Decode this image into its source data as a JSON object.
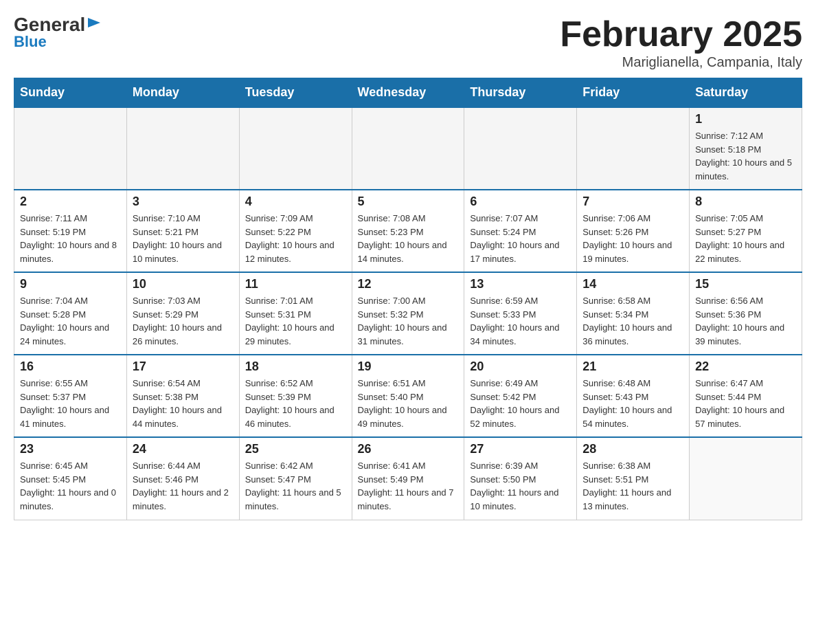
{
  "header": {
    "logo_general": "General",
    "logo_blue": "Blue",
    "month_title": "February 2025",
    "location": "Mariglianella, Campania, Italy"
  },
  "weekdays": [
    "Sunday",
    "Monday",
    "Tuesday",
    "Wednesday",
    "Thursday",
    "Friday",
    "Saturday"
  ],
  "weeks": [
    [
      {
        "day": "",
        "info": ""
      },
      {
        "day": "",
        "info": ""
      },
      {
        "day": "",
        "info": ""
      },
      {
        "day": "",
        "info": ""
      },
      {
        "day": "",
        "info": ""
      },
      {
        "day": "",
        "info": ""
      },
      {
        "day": "1",
        "info": "Sunrise: 7:12 AM\nSunset: 5:18 PM\nDaylight: 10 hours and 5 minutes."
      }
    ],
    [
      {
        "day": "2",
        "info": "Sunrise: 7:11 AM\nSunset: 5:19 PM\nDaylight: 10 hours and 8 minutes."
      },
      {
        "day": "3",
        "info": "Sunrise: 7:10 AM\nSunset: 5:21 PM\nDaylight: 10 hours and 10 minutes."
      },
      {
        "day": "4",
        "info": "Sunrise: 7:09 AM\nSunset: 5:22 PM\nDaylight: 10 hours and 12 minutes."
      },
      {
        "day": "5",
        "info": "Sunrise: 7:08 AM\nSunset: 5:23 PM\nDaylight: 10 hours and 14 minutes."
      },
      {
        "day": "6",
        "info": "Sunrise: 7:07 AM\nSunset: 5:24 PM\nDaylight: 10 hours and 17 minutes."
      },
      {
        "day": "7",
        "info": "Sunrise: 7:06 AM\nSunset: 5:26 PM\nDaylight: 10 hours and 19 minutes."
      },
      {
        "day": "8",
        "info": "Sunrise: 7:05 AM\nSunset: 5:27 PM\nDaylight: 10 hours and 22 minutes."
      }
    ],
    [
      {
        "day": "9",
        "info": "Sunrise: 7:04 AM\nSunset: 5:28 PM\nDaylight: 10 hours and 24 minutes."
      },
      {
        "day": "10",
        "info": "Sunrise: 7:03 AM\nSunset: 5:29 PM\nDaylight: 10 hours and 26 minutes."
      },
      {
        "day": "11",
        "info": "Sunrise: 7:01 AM\nSunset: 5:31 PM\nDaylight: 10 hours and 29 minutes."
      },
      {
        "day": "12",
        "info": "Sunrise: 7:00 AM\nSunset: 5:32 PM\nDaylight: 10 hours and 31 minutes."
      },
      {
        "day": "13",
        "info": "Sunrise: 6:59 AM\nSunset: 5:33 PM\nDaylight: 10 hours and 34 minutes."
      },
      {
        "day": "14",
        "info": "Sunrise: 6:58 AM\nSunset: 5:34 PM\nDaylight: 10 hours and 36 minutes."
      },
      {
        "day": "15",
        "info": "Sunrise: 6:56 AM\nSunset: 5:36 PM\nDaylight: 10 hours and 39 minutes."
      }
    ],
    [
      {
        "day": "16",
        "info": "Sunrise: 6:55 AM\nSunset: 5:37 PM\nDaylight: 10 hours and 41 minutes."
      },
      {
        "day": "17",
        "info": "Sunrise: 6:54 AM\nSunset: 5:38 PM\nDaylight: 10 hours and 44 minutes."
      },
      {
        "day": "18",
        "info": "Sunrise: 6:52 AM\nSunset: 5:39 PM\nDaylight: 10 hours and 46 minutes."
      },
      {
        "day": "19",
        "info": "Sunrise: 6:51 AM\nSunset: 5:40 PM\nDaylight: 10 hours and 49 minutes."
      },
      {
        "day": "20",
        "info": "Sunrise: 6:49 AM\nSunset: 5:42 PM\nDaylight: 10 hours and 52 minutes."
      },
      {
        "day": "21",
        "info": "Sunrise: 6:48 AM\nSunset: 5:43 PM\nDaylight: 10 hours and 54 minutes."
      },
      {
        "day": "22",
        "info": "Sunrise: 6:47 AM\nSunset: 5:44 PM\nDaylight: 10 hours and 57 minutes."
      }
    ],
    [
      {
        "day": "23",
        "info": "Sunrise: 6:45 AM\nSunset: 5:45 PM\nDaylight: 11 hours and 0 minutes."
      },
      {
        "day": "24",
        "info": "Sunrise: 6:44 AM\nSunset: 5:46 PM\nDaylight: 11 hours and 2 minutes."
      },
      {
        "day": "25",
        "info": "Sunrise: 6:42 AM\nSunset: 5:47 PM\nDaylight: 11 hours and 5 minutes."
      },
      {
        "day": "26",
        "info": "Sunrise: 6:41 AM\nSunset: 5:49 PM\nDaylight: 11 hours and 7 minutes."
      },
      {
        "day": "27",
        "info": "Sunrise: 6:39 AM\nSunset: 5:50 PM\nDaylight: 11 hours and 10 minutes."
      },
      {
        "day": "28",
        "info": "Sunrise: 6:38 AM\nSunset: 5:51 PM\nDaylight: 11 hours and 13 minutes."
      },
      {
        "day": "",
        "info": ""
      }
    ]
  ]
}
